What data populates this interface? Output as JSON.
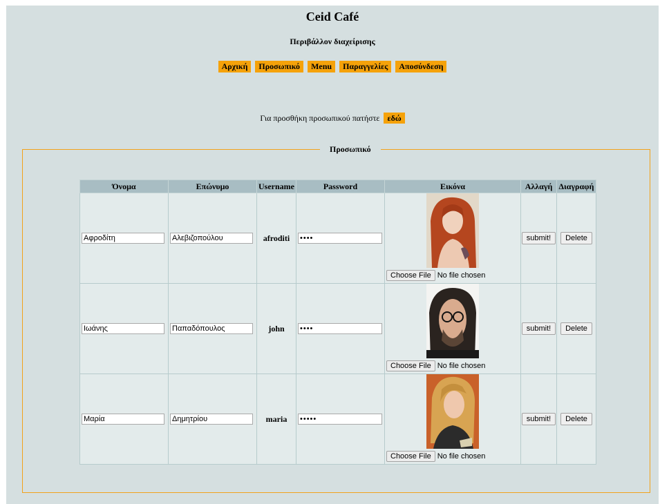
{
  "header": {
    "title": "Ceid Café",
    "subtitle": "Περιβάλλον διαχείρισης"
  },
  "nav": {
    "items": [
      "Αρχική",
      "Προσωπικό",
      "Menu",
      "Παραγγελίες",
      "Αποσύνδεση"
    ]
  },
  "add_staff": {
    "text": "Για προσθήκη προσωπικού πατήστε",
    "link": "εδώ"
  },
  "staff_section": {
    "legend": "Προσωπικό",
    "columns": [
      "Όνομα",
      "Επώνυμο",
      "Username",
      "Password",
      "Εικόνα",
      "Αλλαγή",
      "Διαγραφή"
    ],
    "rows": [
      {
        "first_name": "Αφροδίτη",
        "last_name": "Αλεβιζοπούλου",
        "username": "afroditi",
        "password": "••••",
        "file_button": "Choose File",
        "file_status": "No file chosen",
        "submit": "submit!",
        "delete": "Delete"
      },
      {
        "first_name": "Ιωάνης",
        "last_name": "Παπαδόπουλος",
        "username": "john",
        "password": "••••",
        "file_button": "Choose File",
        "file_status": "No file chosen",
        "submit": "submit!",
        "delete": "Delete"
      },
      {
        "first_name": "Μαρία",
        "last_name": "Δημητρίου",
        "username": "maria",
        "password": "•••••",
        "file_button": "Choose File",
        "file_status": "No file chosen",
        "submit": "submit!",
        "delete": "Delete"
      }
    ]
  },
  "colors": {
    "background": "#d5dfe0",
    "accent": "#f5a20a",
    "table_header": "#a8bdc3"
  }
}
